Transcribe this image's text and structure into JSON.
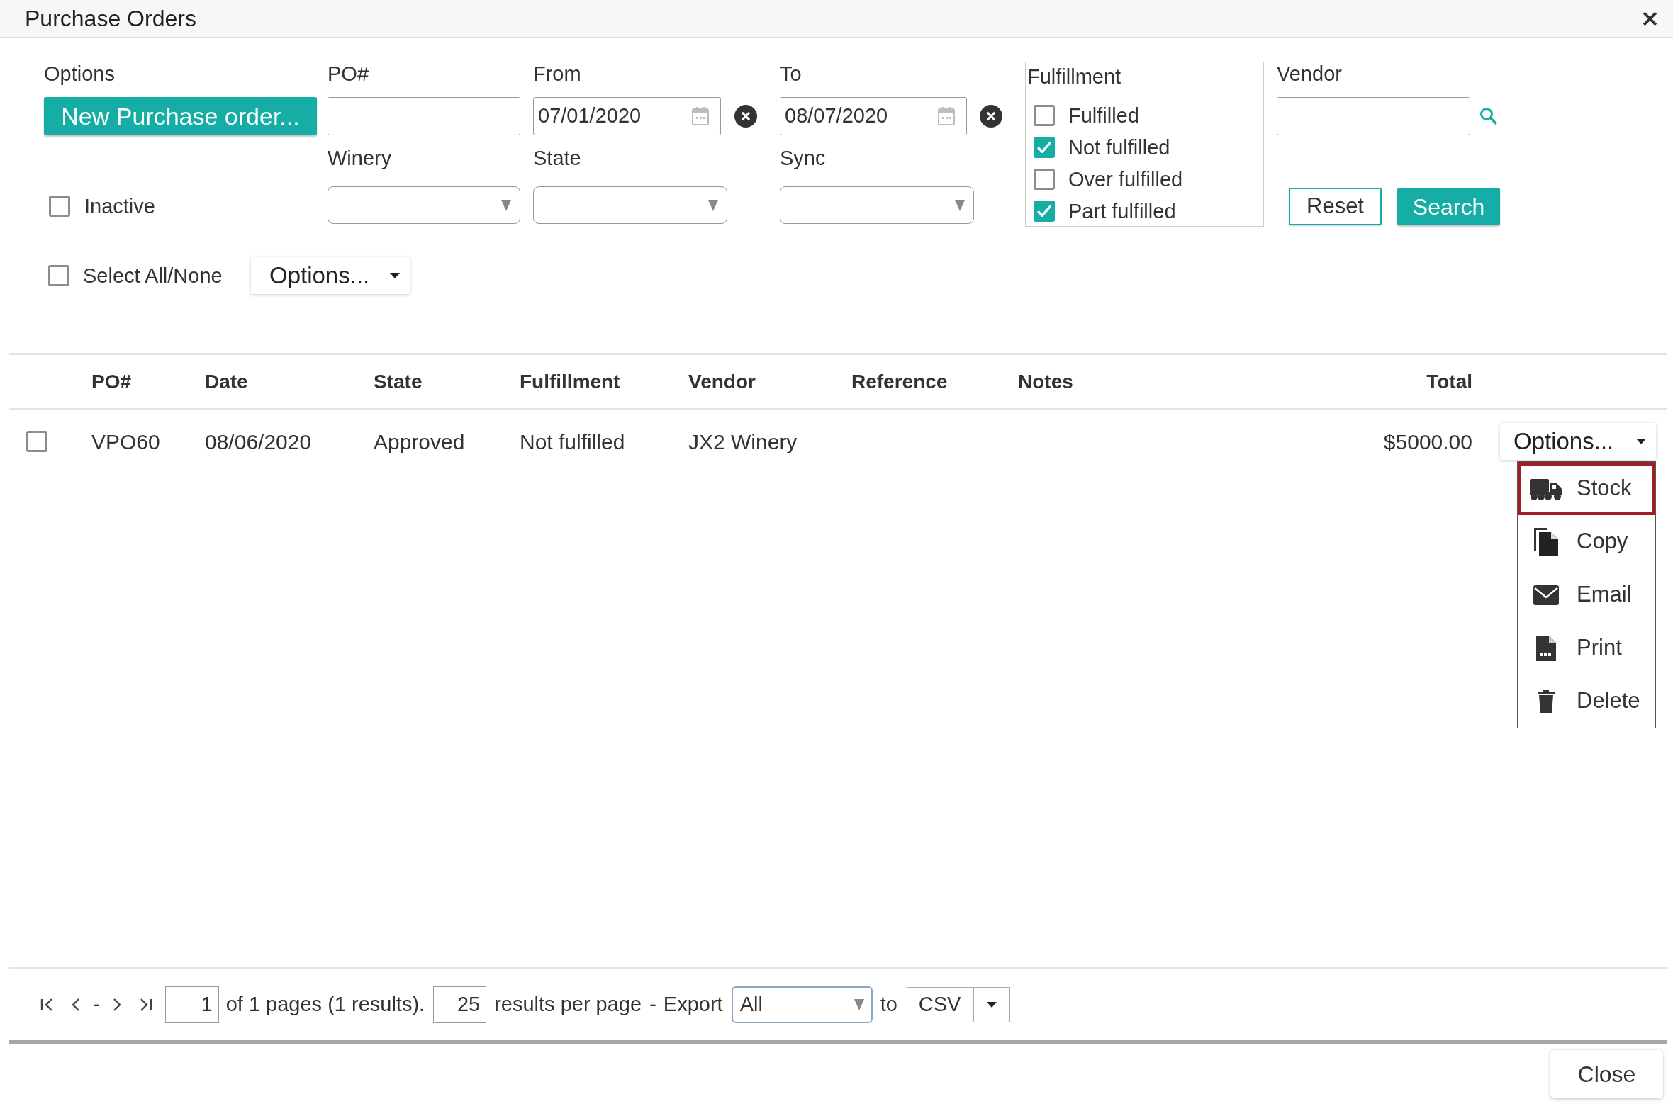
{
  "window": {
    "title": "Purchase Orders"
  },
  "filters": {
    "options_label": "Options",
    "new_order_button": "New Purchase order...",
    "po_number": {
      "label": "PO#"
    },
    "from_date": {
      "label": "From",
      "value": "07/01/2020"
    },
    "to_date": {
      "label": "To",
      "value": "08/07/2020"
    },
    "winery": {
      "label": "Winery"
    },
    "state": {
      "label": "State"
    },
    "sync": {
      "label": "Sync"
    },
    "inactive": {
      "label": "Inactive",
      "checked": false
    },
    "fulfillment": {
      "title": "Fulfillment",
      "options": [
        {
          "label": "Fulfilled",
          "checked": false
        },
        {
          "label": "Not fulfilled",
          "checked": true
        },
        {
          "label": "Over fulfilled",
          "checked": false
        },
        {
          "label": "Part fulfilled",
          "checked": true
        }
      ]
    },
    "vendor": {
      "label": "Vendor"
    },
    "reset_button": "Reset",
    "search_button": "Search"
  },
  "bulk_actions": {
    "select_all": {
      "label": "Select All/None",
      "checked": false
    },
    "options_button": "Options..."
  },
  "table": {
    "columns": [
      "PO#",
      "Date",
      "State",
      "Fulfillment",
      "Vendor",
      "Reference",
      "Notes",
      "Total"
    ],
    "rows": [
      {
        "checked": false,
        "po_number": "VPO60",
        "date": "08/06/2020",
        "state": "Approved",
        "fulfillment": "Not fulfilled",
        "vendor": "JX2 Winery",
        "total": "$5000.00",
        "options_button": "Options..."
      }
    ]
  },
  "row_menu": {
    "items": [
      {
        "kind": "stock",
        "label": "Stock",
        "selected": true
      },
      {
        "kind": "copy",
        "label": "Copy",
        "selected": false
      },
      {
        "kind": "email",
        "label": "Email",
        "selected": false
      },
      {
        "kind": "print",
        "label": "Print",
        "selected": false
      },
      {
        "kind": "delete",
        "label": "Delete",
        "selected": false
      }
    ]
  },
  "pagination": {
    "nav_separator": "-",
    "page": "1",
    "page_info": "of 1 pages (1 results).",
    "per_page": "25",
    "per_page_label": "results per page",
    "separator": "-",
    "export_label": "Export",
    "export_scope": "All",
    "to_label": "to",
    "format": "CSV"
  },
  "footer": {
    "close_button": "Close"
  }
}
